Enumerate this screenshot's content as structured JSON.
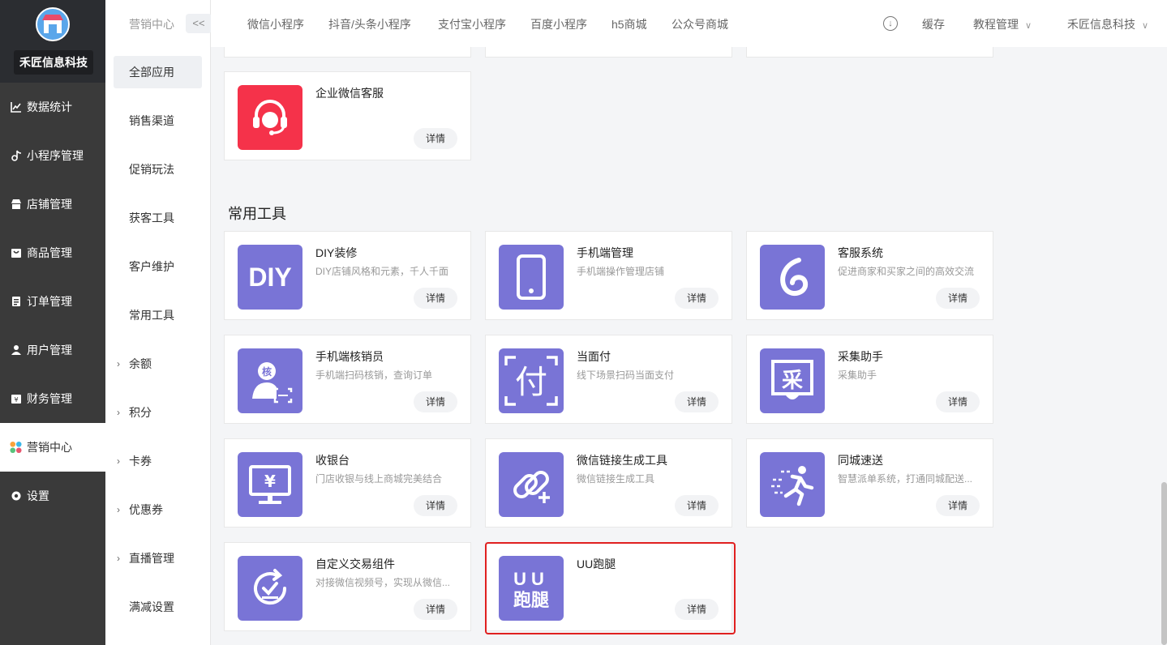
{
  "brand": {
    "name": "禾匠信息科技"
  },
  "main_nav": [
    {
      "label": "数据统计",
      "icon": "chart-icon"
    },
    {
      "label": "小程序管理",
      "icon": "tiktok-icon"
    },
    {
      "label": "店铺管理",
      "icon": "store-icon"
    },
    {
      "label": "商品管理",
      "icon": "goods-icon"
    },
    {
      "label": "订单管理",
      "icon": "order-icon"
    },
    {
      "label": "用户管理",
      "icon": "user-icon"
    },
    {
      "label": "财务管理",
      "icon": "finance-icon"
    },
    {
      "label": "营销中心",
      "icon": "marketing-icon",
      "active": true
    },
    {
      "label": "设置",
      "icon": "gear-icon"
    }
  ],
  "subnav": {
    "title": "营销中心",
    "collapse_label": "<<",
    "items": [
      {
        "label": "全部应用",
        "active": true
      },
      {
        "label": "销售渠道"
      },
      {
        "label": "促销玩法"
      },
      {
        "label": "获客工具"
      },
      {
        "label": "客户维护"
      },
      {
        "label": "常用工具"
      },
      {
        "label": "余额",
        "expandable": true
      },
      {
        "label": "积分",
        "expandable": true
      },
      {
        "label": "卡券",
        "expandable": true
      },
      {
        "label": "优惠券",
        "expandable": true
      },
      {
        "label": "直播管理",
        "expandable": true
      },
      {
        "label": "满减设置"
      }
    ]
  },
  "topbar": {
    "tabs": [
      "微信小程序",
      "抖音/头条小程序",
      "支付宝小程序",
      "百度小程序",
      "h5商城",
      "公众号商城"
    ],
    "cache_label": "缓存",
    "tutorial_label": "教程管理",
    "account_label": "禾匠信息科技"
  },
  "top_card": {
    "title": "企业微信客服",
    "detail": "详情",
    "icon_color": "#f5324a"
  },
  "section": {
    "title": "常用工具"
  },
  "tools": [
    {
      "title": "DIY装修",
      "desc": "DIY店铺风格和元素，千人千面",
      "detail": "详情",
      "icon": "diy-icon"
    },
    {
      "title": "手机端管理",
      "desc": "手机端操作管理店铺",
      "detail": "详情",
      "icon": "phone-icon"
    },
    {
      "title": "客服系统",
      "desc": "促进商家和买家之间的高效交流",
      "detail": "详情",
      "icon": "customer-service-icon"
    },
    {
      "title": "手机端核销员",
      "desc": "手机端扫码核销，查询订单",
      "detail": "详情",
      "icon": "verify-icon",
      "icon_text": "核"
    },
    {
      "title": "当面付",
      "desc": "线下场景扫码当面支付",
      "detail": "详情",
      "icon": "pay-icon",
      "icon_text": "付"
    },
    {
      "title": "采集助手",
      "desc": "采集助手",
      "detail": "详情",
      "icon": "collect-icon",
      "icon_text": "采"
    },
    {
      "title": "收银台",
      "desc": "门店收银与线上商城完美结合",
      "detail": "详情",
      "icon": "cashier-icon",
      "icon_text": "¥"
    },
    {
      "title": "微信链接生成工具",
      "desc": "微信链接生成工具",
      "detail": "详情",
      "icon": "link-icon"
    },
    {
      "title": "同城速送",
      "desc": "智慧派单系统，打通同城配送...",
      "detail": "详情",
      "icon": "runner-icon"
    },
    {
      "title": "自定义交易组件",
      "desc": "对接微信视频号，实现从微信...",
      "detail": "详情",
      "icon": "trade-component-icon"
    },
    {
      "title": "UU跑腿",
      "desc": "",
      "detail": "详情",
      "icon": "uu-icon",
      "icon_text": "UU",
      "icon_text2": "跑腿"
    }
  ],
  "colors": {
    "accent": "#7974d6",
    "highlight": "#e02020",
    "sidebar": "#3a3a3a"
  }
}
